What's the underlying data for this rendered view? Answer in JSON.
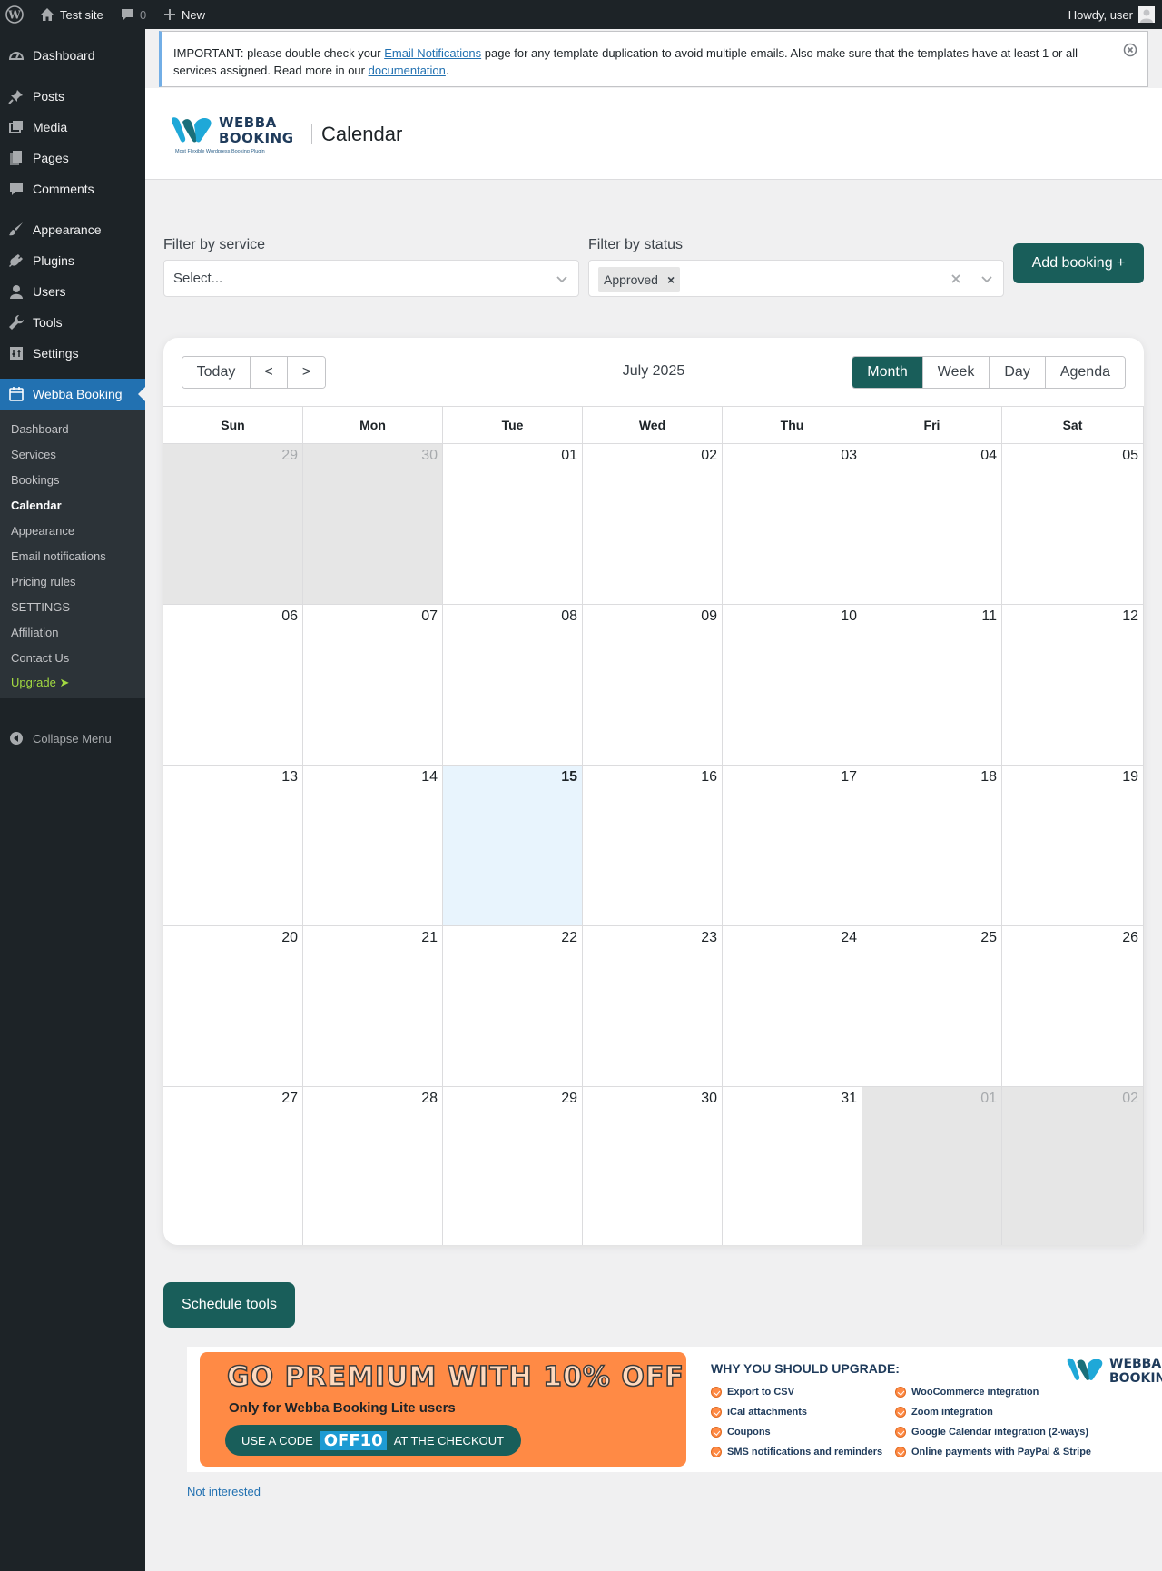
{
  "adminbar": {
    "site_name": "Test site",
    "comments_count": "0",
    "new_label": "New",
    "howdy": "Howdy, user"
  },
  "sidebar": {
    "items": [
      {
        "label": "Dashboard",
        "icon": "dashboard-icon"
      },
      {
        "label": "Posts",
        "icon": "pin-icon"
      },
      {
        "label": "Media",
        "icon": "media-icon"
      },
      {
        "label": "Pages",
        "icon": "pages-icon"
      },
      {
        "label": "Comments",
        "icon": "comment-icon"
      },
      {
        "label": "Appearance",
        "icon": "brush-icon"
      },
      {
        "label": "Plugins",
        "icon": "plug-icon"
      },
      {
        "label": "Users",
        "icon": "user-icon"
      },
      {
        "label": "Tools",
        "icon": "wrench-icon"
      },
      {
        "label": "Settings",
        "icon": "settings-icon"
      },
      {
        "label": "Webba Booking",
        "icon": "calendar-icon"
      }
    ],
    "submenu": [
      "Dashboard",
      "Services",
      "Bookings",
      "Calendar",
      "Appearance",
      "Email notifications",
      "Pricing rules",
      "SETTINGS",
      "Affiliation",
      "Contact Us",
      "Upgrade ➤"
    ],
    "collapse_label": "Collapse Menu"
  },
  "notice": {
    "text_1": "IMPORTANT: please double check your ",
    "link_1": "Email Notifications",
    "text_2": " page for any template duplication to avoid multiple emails. Also make sure that the templates have at least 1 or all services assigned. Read more in our ",
    "link_2": "documentation",
    "text_3": "."
  },
  "header": {
    "logo_line1": "WEBBA",
    "logo_line2": "BOOKING",
    "logo_tagline": "Most Flexible Wordpress Booking Plugin",
    "title": "Calendar"
  },
  "filters": {
    "service_label": "Filter by service",
    "service_placeholder": "Select...",
    "status_label": "Filter by status",
    "status_chip": "Approved",
    "status_chip_remove": "×",
    "add_booking": "Add booking +"
  },
  "calendar": {
    "nav": [
      "Today",
      "<",
      ">"
    ],
    "title": "July 2025",
    "views": [
      "Month",
      "Week",
      "Day",
      "Agenda"
    ],
    "active_view": "Month",
    "weekdays": [
      "Sun",
      "Mon",
      "Tue",
      "Wed",
      "Thu",
      "Fri",
      "Sat"
    ],
    "weeks": [
      [
        "29",
        "30",
        "01",
        "02",
        "03",
        "04",
        "05"
      ],
      [
        "06",
        "07",
        "08",
        "09",
        "10",
        "11",
        "12"
      ],
      [
        "13",
        "14",
        "15",
        "16",
        "17",
        "18",
        "19"
      ],
      [
        "20",
        "21",
        "22",
        "23",
        "24",
        "25",
        "26"
      ],
      [
        "27",
        "28",
        "29",
        "30",
        "31",
        "01",
        "02"
      ]
    ],
    "off_range": [
      [
        0,
        0
      ],
      [
        0,
        1
      ],
      [
        4,
        5
      ],
      [
        4,
        6
      ]
    ],
    "today": [
      2,
      2
    ]
  },
  "schedule_tools": "Schedule tools",
  "promo": {
    "headline": "GO PREMIUM WITH 10% OFF",
    "subline": "Only for Webba Booking Lite users",
    "code_prefix": "USE A CODE",
    "code": "OFF10",
    "code_suffix": "AT THE CHECKOUT",
    "why_title": "WHY YOU SHOULD UPGRADE:",
    "features_left": [
      "Export to CSV",
      "iCal attachments",
      "Coupons",
      "SMS notifications and reminders"
    ],
    "features_right": [
      "WooCommerce integration",
      "Zoom integration",
      "Google Calendar integration (2-ways)",
      "Online payments with PayPal & Stripe"
    ],
    "logo_line1": "WEBBA",
    "logo_line2": "BOOKIN"
  },
  "not_interested": "Not interested",
  "colors": {
    "accent": "#195e5a",
    "wp_blue": "#2271b1",
    "admin_dark": "#1d2327",
    "today_bg": "#e8f4fd",
    "off_bg": "#e6e6e6",
    "promo_orange": "#ff8a45"
  }
}
